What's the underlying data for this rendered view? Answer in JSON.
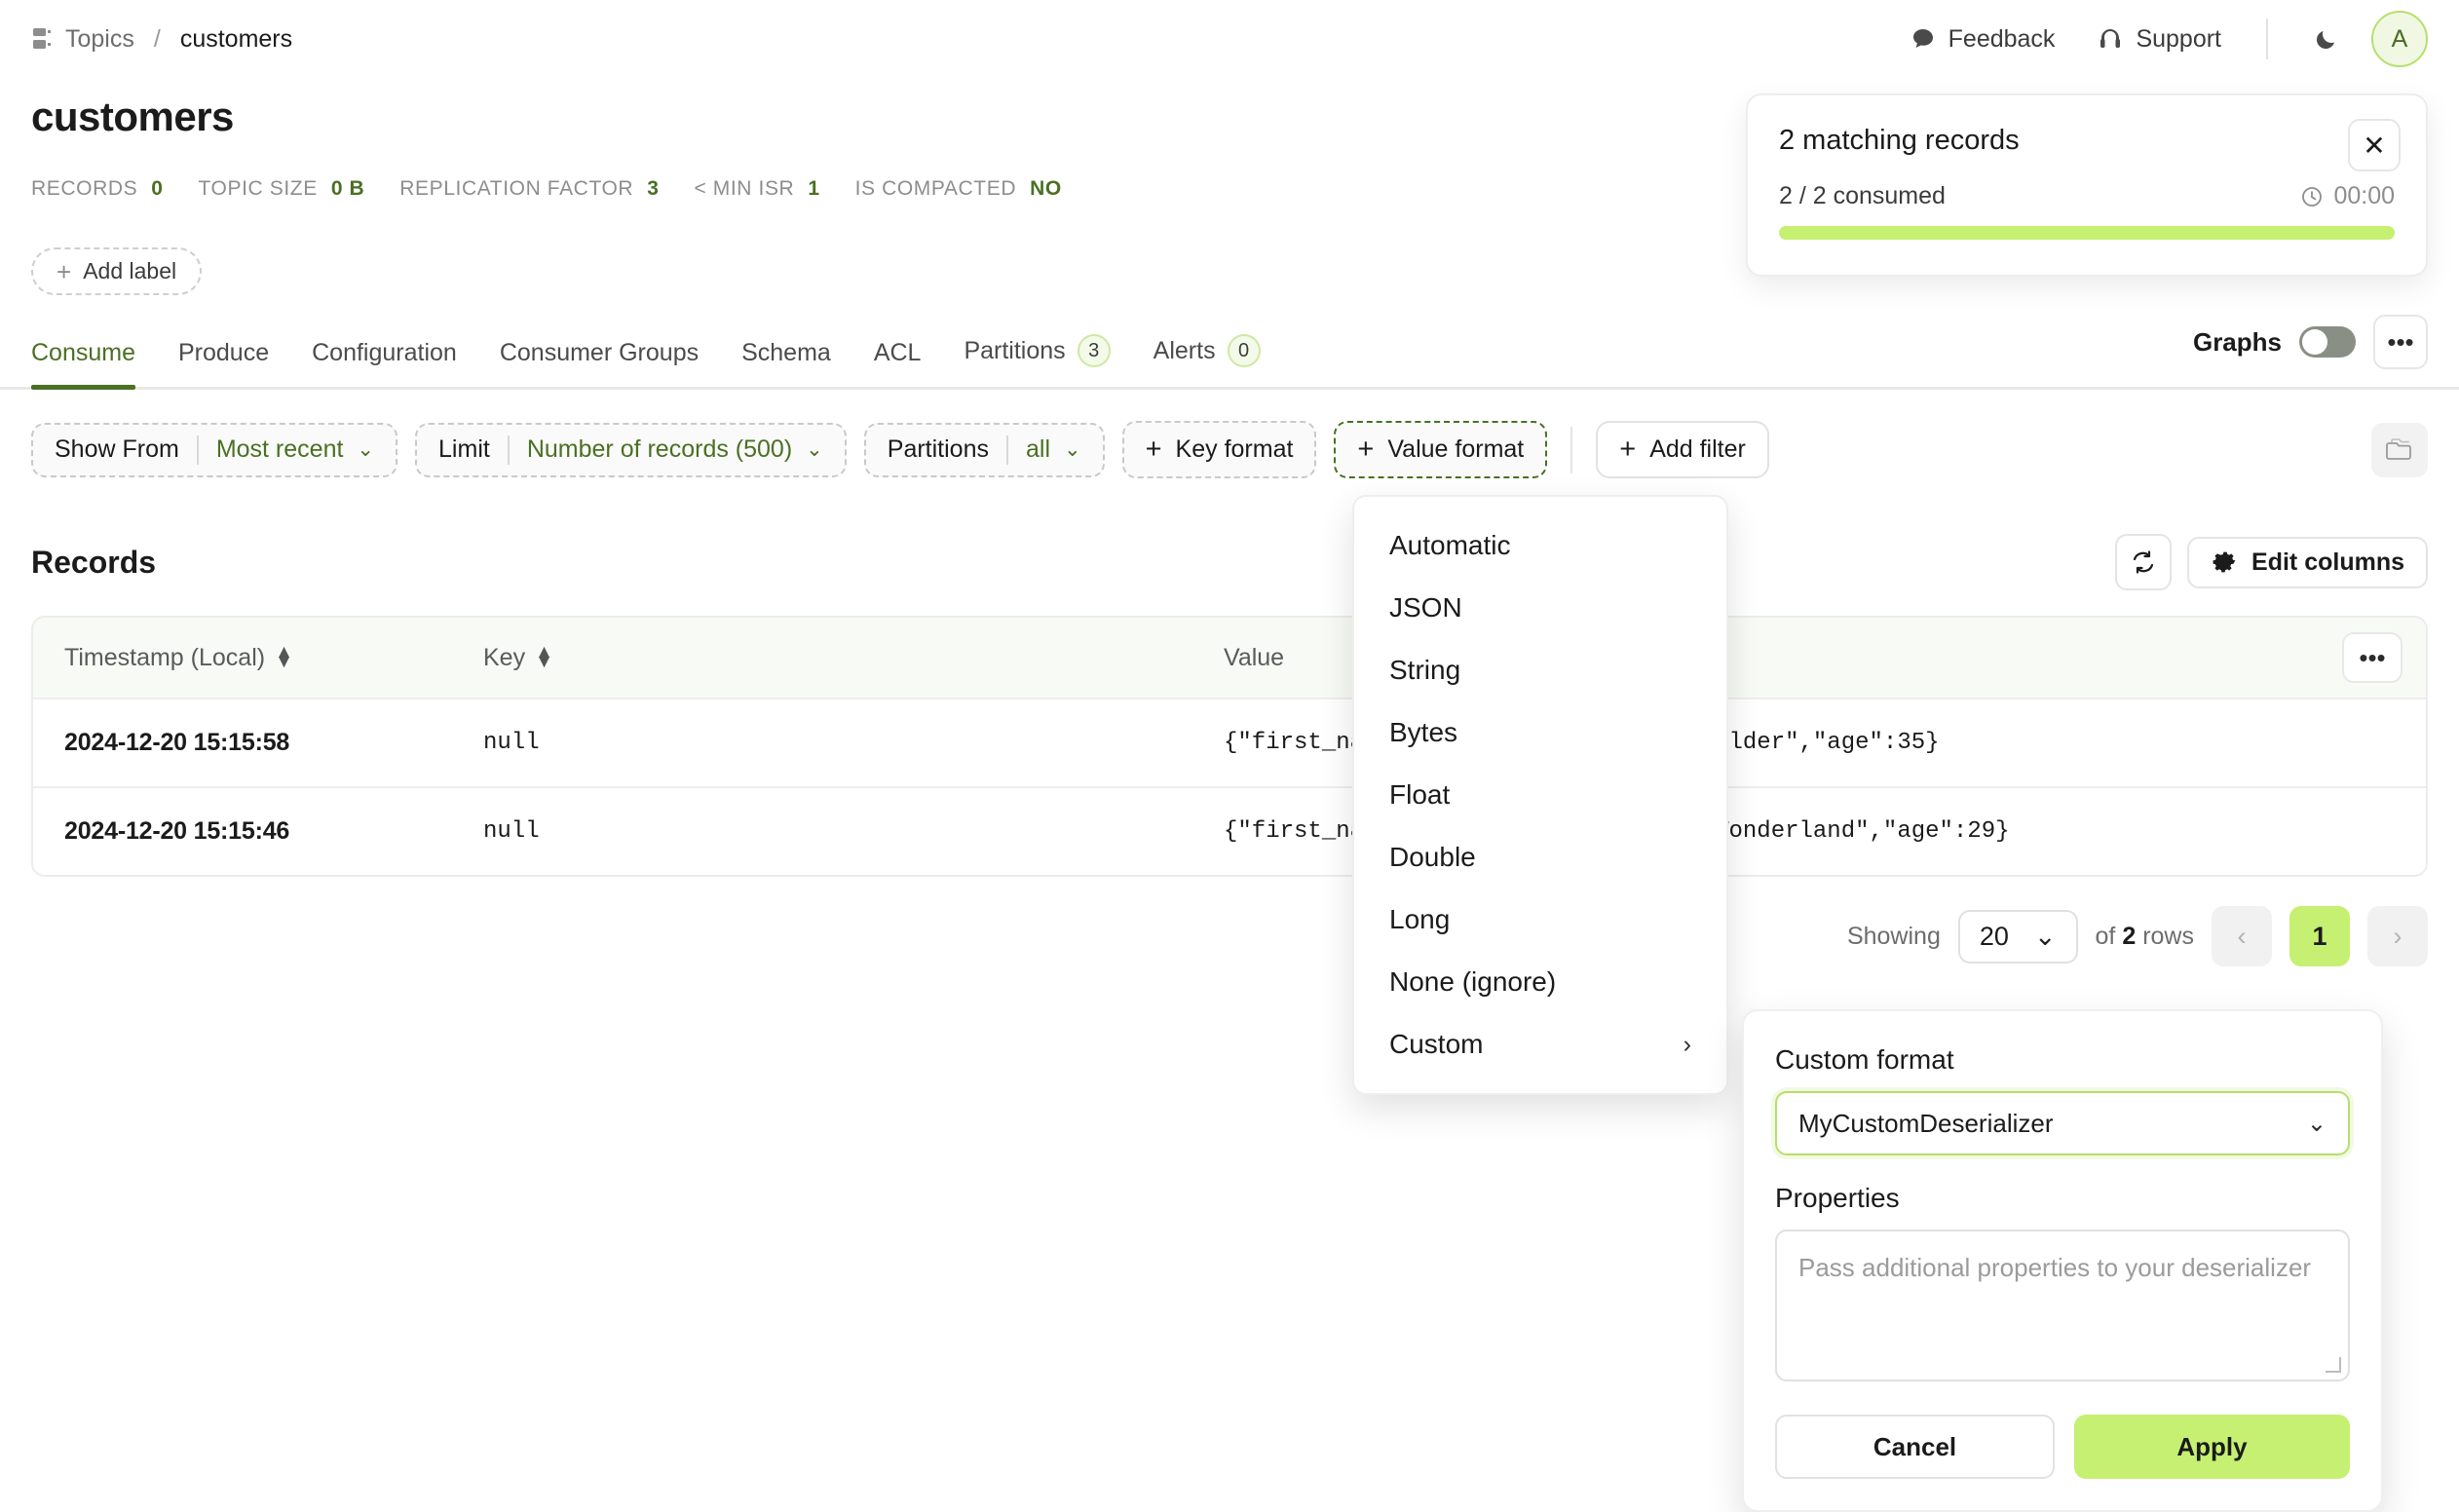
{
  "breadcrumb": {
    "icon": "topics-icon",
    "root": "Topics",
    "separator": "/",
    "current": "customers"
  },
  "topbar": {
    "feedback": "Feedback",
    "support": "Support",
    "theme_icon": "moon-icon",
    "avatar_initial": "A"
  },
  "page": {
    "title": "customers",
    "stats": [
      {
        "label": "RECORDS",
        "value": "0"
      },
      {
        "label": "TOPIC SIZE",
        "value": "0 B"
      },
      {
        "label": "REPLICATION FACTOR",
        "value": "3"
      },
      {
        "label": "< MIN ISR",
        "value": "1"
      },
      {
        "label": "IS COMPACTED",
        "value": "NO"
      }
    ],
    "add_label": "Add label"
  },
  "tabs": [
    {
      "label": "Consume",
      "badge": null,
      "active": true
    },
    {
      "label": "Produce",
      "badge": null,
      "active": false
    },
    {
      "label": "Configuration",
      "badge": null,
      "active": false
    },
    {
      "label": "Consumer Groups",
      "badge": null,
      "active": false
    },
    {
      "label": "Schema",
      "badge": null,
      "active": false
    },
    {
      "label": "ACL",
      "badge": null,
      "active": false
    },
    {
      "label": "Partitions",
      "badge": "3",
      "active": false
    },
    {
      "label": "Alerts",
      "badge": "0",
      "active": false
    }
  ],
  "graphs": {
    "label": "Graphs",
    "enabled": false,
    "more_icon": "ellipsis-icon"
  },
  "filters": {
    "show_from": {
      "key": "Show From",
      "value": "Most recent"
    },
    "limit": {
      "key": "Limit",
      "value": "Number of records (500)"
    },
    "partitions": {
      "key": "Partitions",
      "value": "all"
    },
    "key_format": "Key format",
    "value_format": "Value format",
    "add_filter": "Add filter",
    "copy_icon": "copy-folder-icon"
  },
  "records": {
    "title": "Records",
    "refresh_icon": "refresh-icon",
    "edit_columns": "Edit columns",
    "columns": [
      "Timestamp (Local)",
      "Key",
      "Value"
    ],
    "rows": [
      {
        "timestamp": "2024-12-20 15:15:58",
        "key": "null",
        "value": "{\"first_name\":\"Bob\",\"last_name\":\"Builder\",\"age\":35}"
      },
      {
        "timestamp": "2024-12-20 15:15:46",
        "key": "null",
        "value": "{\"first_name\":\"Alice\",\"last_name\":\"Wonderland\",\"age\":29}"
      }
    ],
    "more_icon": "ellipsis-icon"
  },
  "pagination": {
    "showing_label": "Showing",
    "page_size": "20",
    "of_label": "of",
    "total": "2",
    "rows_label": "rows",
    "prev": "‹",
    "current_page": "1",
    "next": "›"
  },
  "toast": {
    "title": "2 matching records",
    "subtitle": "2 / 2 consumed",
    "timer": "00:00",
    "close_icon": "close-icon",
    "progress_percent": 100,
    "progress_color": "#c6f072"
  },
  "value_format_menu": {
    "items": [
      {
        "label": "Automatic",
        "submenu": false
      },
      {
        "label": "JSON",
        "submenu": false
      },
      {
        "label": "String",
        "submenu": false
      },
      {
        "label": "Bytes",
        "submenu": false
      },
      {
        "label": "Float",
        "submenu": false
      },
      {
        "label": "Double",
        "submenu": false
      },
      {
        "label": "Long",
        "submenu": false
      },
      {
        "label": "None (ignore)",
        "submenu": false
      },
      {
        "label": "Custom",
        "submenu": true
      }
    ]
  },
  "custom_format_popup": {
    "heading": "Custom format",
    "selected_deserializer": "MyCustomDeserializer",
    "properties_label": "Properties",
    "properties_placeholder": "Pass additional properties to your deserializer",
    "properties_value": "",
    "cancel": "Cancel",
    "apply": "Apply"
  },
  "colors": {
    "accent_green": "#4a7023",
    "lime": "#c6f072",
    "badge_border": "#cfe8a3"
  }
}
